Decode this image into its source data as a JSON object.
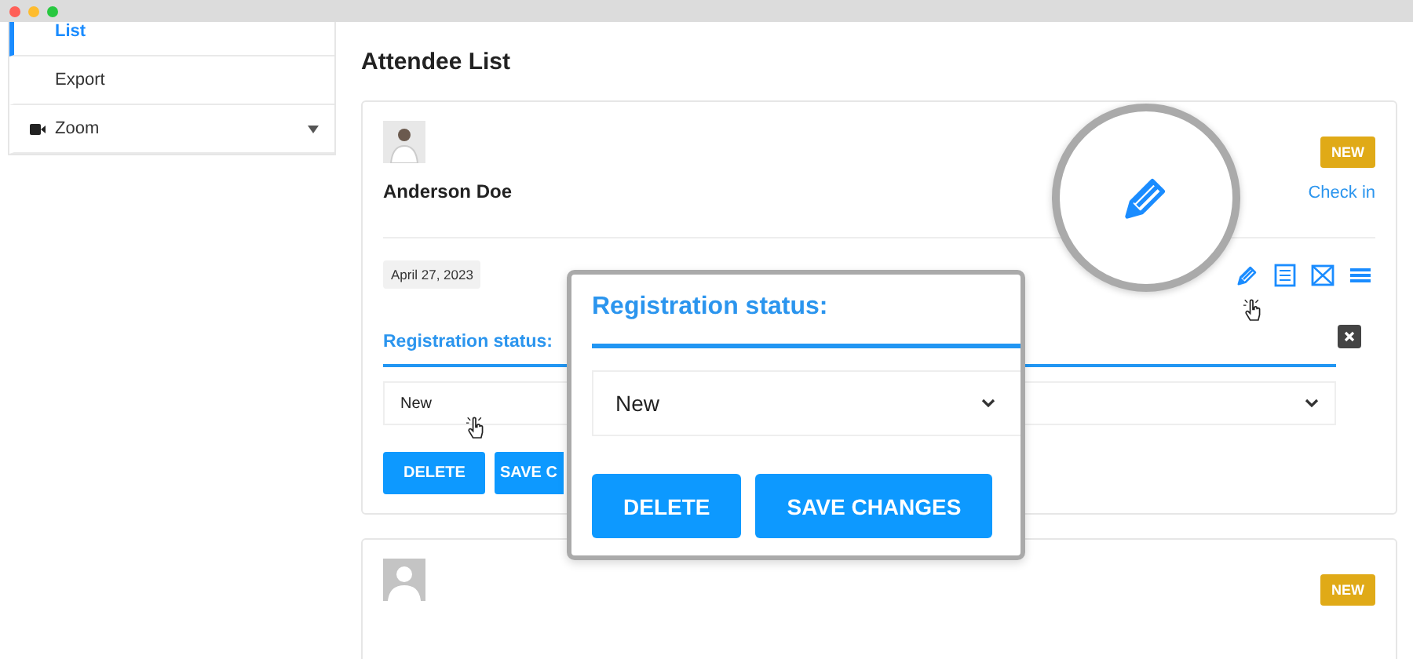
{
  "sidebar": {
    "items": [
      {
        "label": "List",
        "selected": true,
        "kind": "link"
      },
      {
        "label": "Export",
        "selected": false,
        "kind": "link"
      },
      {
        "label": "Zoom",
        "selected": false,
        "kind": "group"
      }
    ]
  },
  "title": "Attendee List",
  "attendees": [
    {
      "avatar": {
        "kind": "photo"
      },
      "name": "Anderson Doe",
      "badge": "NEW",
      "action": "Check in",
      "date": "April 27, 2023",
      "registration": {
        "label": "Registration status:",
        "value": "New"
      },
      "buttons": [
        "DELETE",
        "SAVE C"
      ]
    },
    {
      "avatar": {
        "kind": "silhouette"
      },
      "badge": "NEW"
    }
  ],
  "popup": {
    "label": "Registration status:",
    "value": "New",
    "buttons": [
      "DELETE",
      "SAVE CHANGES"
    ]
  }
}
